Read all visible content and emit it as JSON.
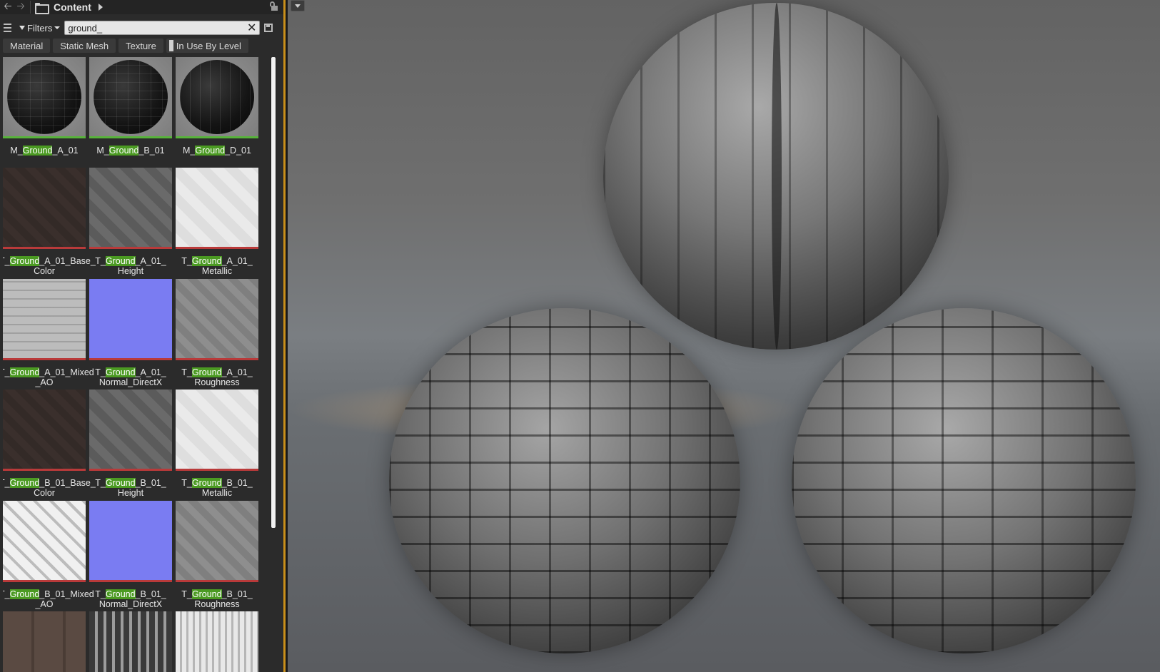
{
  "browser": {
    "path": "Content",
    "filters_label": "Filters",
    "search": {
      "value": "ground_"
    },
    "chips": [
      {
        "label": "Material"
      },
      {
        "label": "Static Mesh"
      },
      {
        "label": "Texture"
      },
      {
        "label": "In Use By Level"
      }
    ],
    "highlight_color": "#4b9a22",
    "assets": [
      {
        "pre": "M_",
        "hl": "Ground",
        "post": "_A_01",
        "kind": "material",
        "thumb": "tiles"
      },
      {
        "pre": "M_",
        "hl": "Ground",
        "post": "_B_01",
        "kind": "material",
        "thumb": "tiles"
      },
      {
        "pre": "M_",
        "hl": "Ground",
        "post": "_D_01",
        "kind": "material",
        "thumb": "ribs"
      },
      {
        "pre": "T_",
        "hl": "Ground",
        "post": "_A_01_Base_ Color",
        "kind": "texture",
        "thumb": "tex-dark"
      },
      {
        "pre": "T_",
        "hl": "Ground",
        "post": "_A_01_ Height",
        "kind": "texture",
        "thumb": "tex-gray"
      },
      {
        "pre": "T_",
        "hl": "Ground",
        "post": "_A_01_ Metallic",
        "kind": "texture",
        "thumb": "tex-white"
      },
      {
        "pre": "T_",
        "hl": "Ground",
        "post": "_A_01_Mixed _AO",
        "kind": "texture",
        "thumb": "tex-white-tiles"
      },
      {
        "pre": "T_",
        "hl": "Ground",
        "post": "_A_01_ Normal_DirectX",
        "kind": "texture",
        "thumb": "tex-blue"
      },
      {
        "pre": "T_",
        "hl": "Ground",
        "post": "_A_01_ Roughness",
        "kind": "texture",
        "thumb": "tex-midgray"
      },
      {
        "pre": "T_",
        "hl": "Ground",
        "post": "_B_01_Base_ Color",
        "kind": "texture",
        "thumb": "tex-dark"
      },
      {
        "pre": "T_",
        "hl": "Ground",
        "post": "_B_01_ Height",
        "kind": "texture",
        "thumb": "tex-gray"
      },
      {
        "pre": "T_",
        "hl": "Ground",
        "post": "_B_01_ Metallic",
        "kind": "texture",
        "thumb": "tex-white"
      },
      {
        "pre": "T_",
        "hl": "Ground",
        "post": "_B_01_Mixed _AO",
        "kind": "texture",
        "thumb": "tex-diag-white"
      },
      {
        "pre": "T_",
        "hl": "Ground",
        "post": "_B_01_ Normal_DirectX",
        "kind": "texture",
        "thumb": "tex-blue"
      },
      {
        "pre": "T_",
        "hl": "Ground",
        "post": "_B_01_ Roughness",
        "kind": "texture",
        "thumb": "tex-midgray"
      },
      {
        "pre": "",
        "hl": "",
        "post": "",
        "kind": "texture-partial",
        "thumb": "tex-brown"
      },
      {
        "pre": "",
        "hl": "",
        "post": "",
        "kind": "texture-partial",
        "thumb": "tex-stripes"
      },
      {
        "pre": "",
        "hl": "",
        "post": "",
        "kind": "texture-partial",
        "thumb": "tex-noise"
      }
    ],
    "accent_color": "#c98f1a"
  },
  "viewport": {
    "objects": [
      "ribbed-metal-sphere",
      "tiled-metal-sphere-left",
      "tiled-metal-sphere-right"
    ]
  },
  "icons": [
    "back-arrow-icon",
    "forward-arrow-icon",
    "folder-icon",
    "lock-icon",
    "view-options-icon",
    "filter-icon",
    "clear-icon",
    "save-search-icon"
  ]
}
